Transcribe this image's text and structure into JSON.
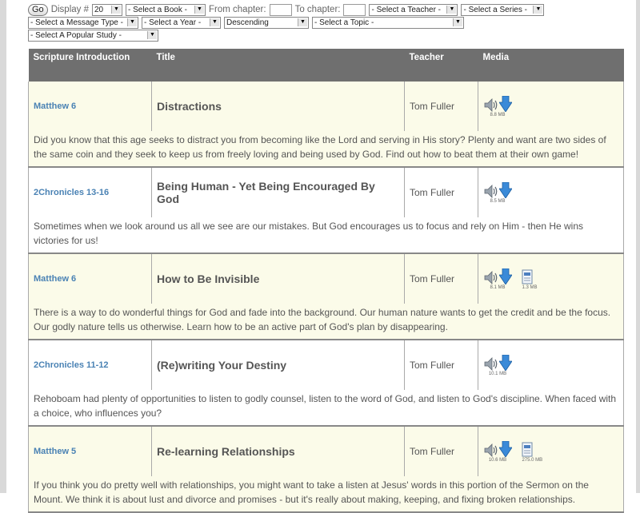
{
  "filters": {
    "go_label": "Go",
    "display_label": "Display #",
    "display_value": "20",
    "book": "- Select a Book -",
    "from_label": "From chapter:",
    "to_label": "To chapter:",
    "teacher": "- Select a Teacher -",
    "series": "- Select a Series -",
    "message_type": "- Select a Message Type -",
    "year": "- Select a Year -",
    "order": "Descending",
    "topic": "- Select a Topic -",
    "study": "- Select A Popular Study -"
  },
  "table": {
    "headers": {
      "scripture": "Scripture Introduction",
      "title": "Title",
      "teacher": "Teacher",
      "media": "Media"
    },
    "rows": [
      {
        "ref": "Matthew 6",
        "title": "Distractions",
        "teacher": "Tom Fuller",
        "audio_size": "8.8 MB",
        "video_size": "",
        "doc_size": "",
        "desc": "Did you know that this age seeks to distract you from becoming like the Lord and serving in His story? Plenty and want are two sides of the same coin and they seek to keep us from freely loving and being used by God. Find out how to beat them at their own game!"
      },
      {
        "ref": "2Chronicles 13-16",
        "title": "Being Human - Yet Being Encouraged By God",
        "teacher": "Tom Fuller",
        "audio_size": "8.5 MB",
        "video_size": "",
        "doc_size": "",
        "desc": "Sometimes when we look around us all we see are our mistakes. But God encourages us to focus and rely on Him - then He wins victories for us!"
      },
      {
        "ref": "Matthew 6",
        "title": "How to Be Invisible",
        "teacher": "Tom Fuller",
        "audio_size": "8.1 MB",
        "video_size": "",
        "doc_size": "1.3 MB",
        "desc": "There is a way to do wonderful things for God and fade into the background. Our human nature wants to get the credit and be the focus. Our godly nature tells us otherwise. Learn how to be an active part of God's plan by disappearing."
      },
      {
        "ref": "2Chronicles 11-12",
        "title": "(Re)writing Your Destiny",
        "teacher": "Tom Fuller",
        "audio_size": "10.1 MB",
        "video_size": "",
        "doc_size": "",
        "desc": "Rehoboam had plenty of opportunities to listen to godly counsel, listen to the word of God, and listen to God's discipline. When faced with a choice, who influences you?"
      },
      {
        "ref": "Matthew 5",
        "title": "Re-learning Relationships",
        "teacher": "Tom Fuller",
        "audio_size": "10.6 MB",
        "video_size": "",
        "doc_size": "275.0 MB",
        "desc": "If you think you do pretty well with relationships, you might want to take a listen at Jesus' words in this portion of the Sermon on the Mount. We think it is about lust and divorce and promises - but it's really about making, keeping, and fixing broken relationships."
      }
    ]
  }
}
